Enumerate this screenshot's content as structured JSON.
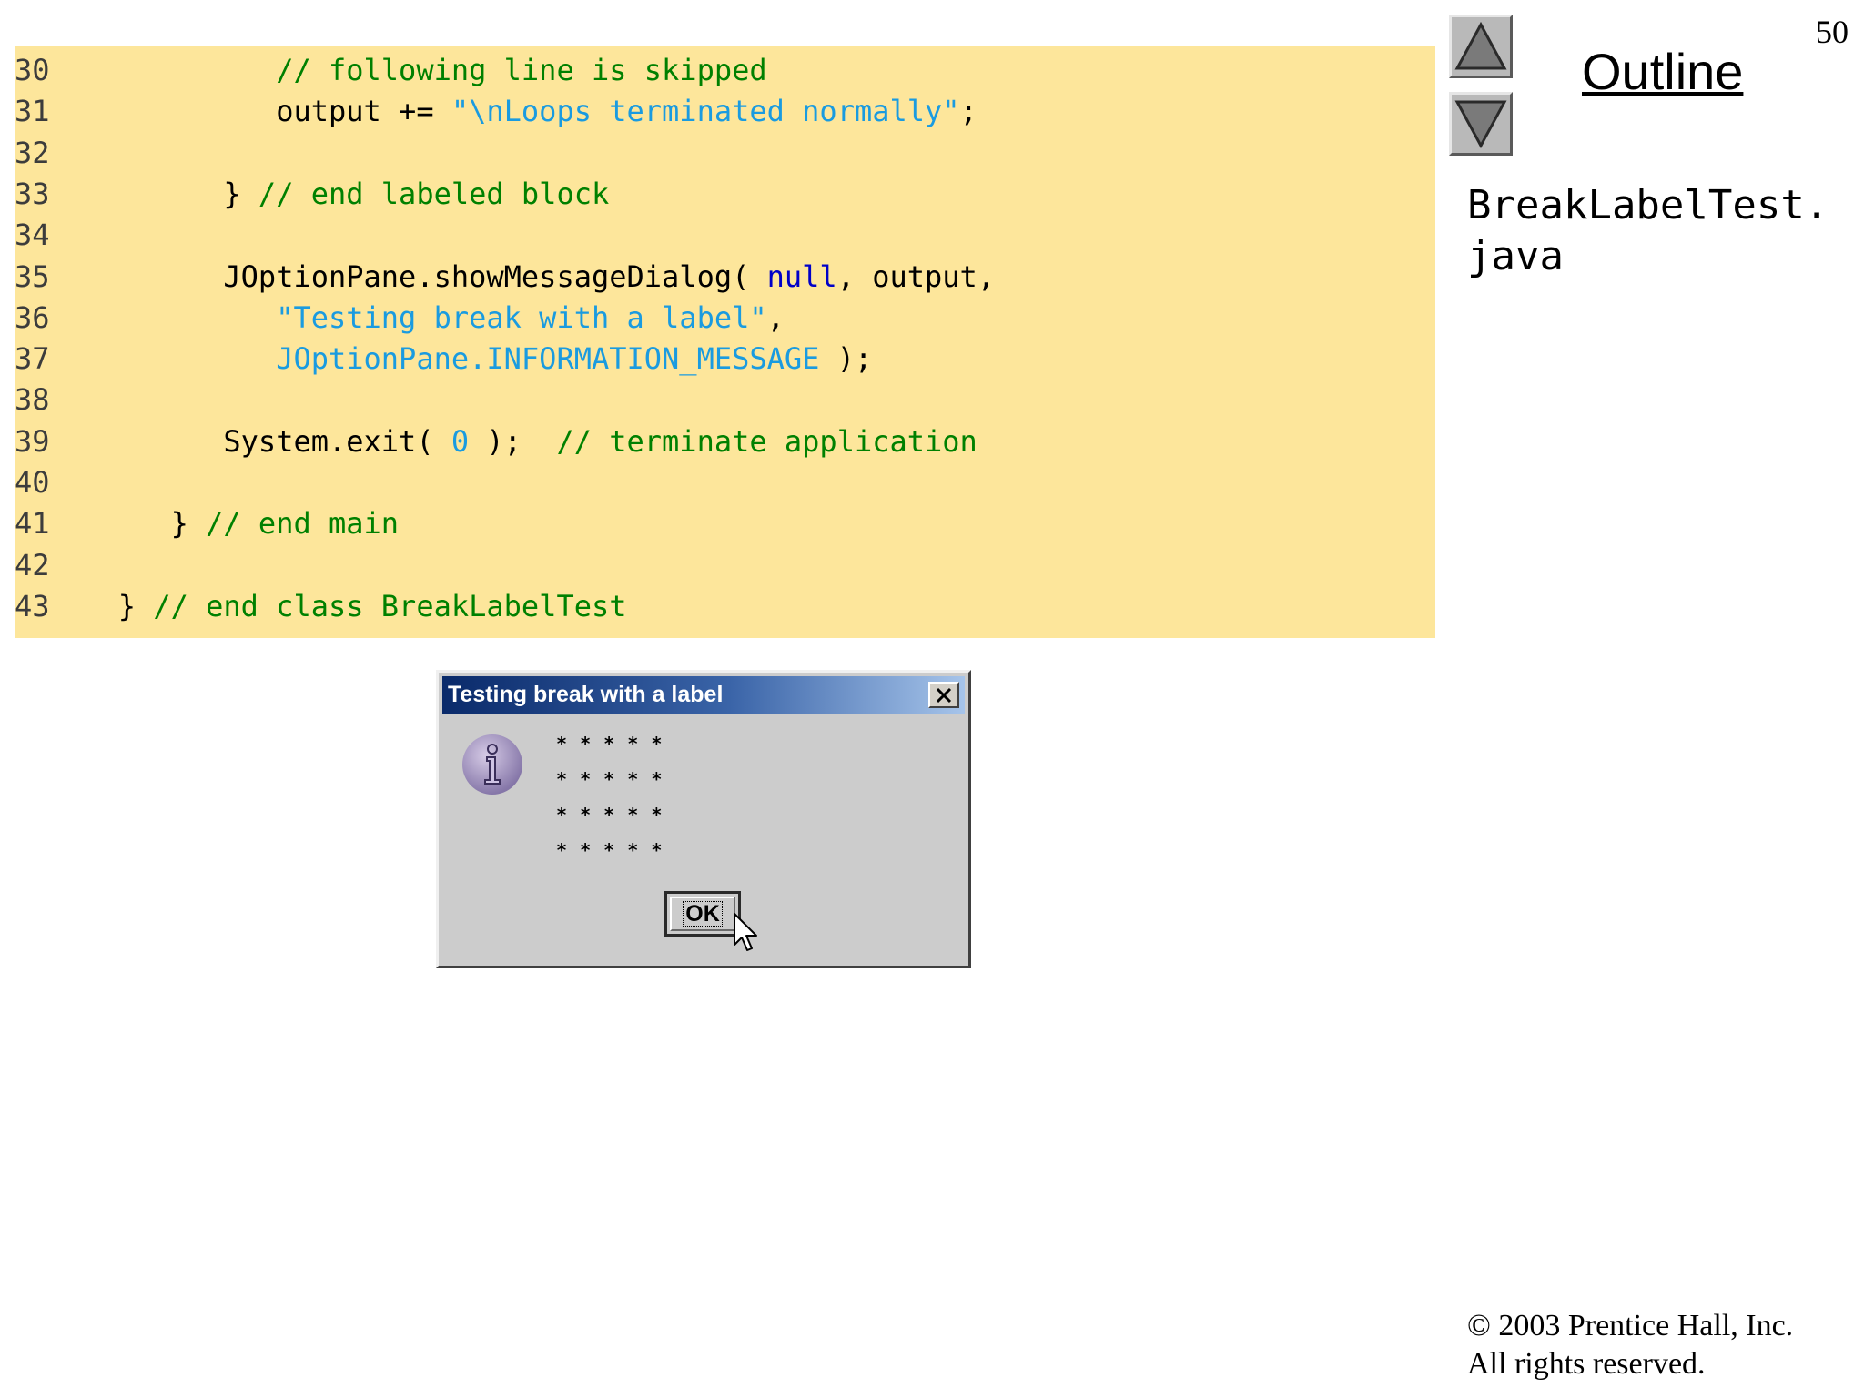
{
  "slide": {
    "page_number": "50",
    "outline_title": "Outline",
    "file_name": "BreakLabelTest.\njava",
    "copyright_line1": "© 2003 Prentice Hall, Inc.",
    "copyright_line2": "All rights reserved."
  },
  "navigation": {
    "up_icon": "triangle-up-icon",
    "down_icon": "triangle-down-icon"
  },
  "code": {
    "background_color": "#fde69b",
    "lines": [
      {
        "number": "30",
        "segments": [
          {
            "text": "            ",
            "type": "plain"
          },
          {
            "text": "// following line is skipped",
            "type": "comment"
          }
        ]
      },
      {
        "number": "31",
        "segments": [
          {
            "text": "            output += ",
            "type": "plain"
          },
          {
            "text": "\"\\nLoops terminated normally\"",
            "type": "string"
          },
          {
            "text": ";",
            "type": "plain"
          }
        ]
      },
      {
        "number": "32",
        "segments": []
      },
      {
        "number": "33",
        "segments": [
          {
            "text": "         } ",
            "type": "plain"
          },
          {
            "text": "// end labeled block",
            "type": "comment"
          }
        ]
      },
      {
        "number": "34",
        "segments": []
      },
      {
        "number": "35",
        "segments": [
          {
            "text": "         JOptionPane.showMessageDialog( ",
            "type": "plain"
          },
          {
            "text": "null",
            "type": "keyword"
          },
          {
            "text": ", output,",
            "type": "plain"
          }
        ]
      },
      {
        "number": "36",
        "segments": [
          {
            "text": "            ",
            "type": "plain"
          },
          {
            "text": "\"Testing break with a label\"",
            "type": "string"
          },
          {
            "text": ",",
            "type": "plain"
          }
        ]
      },
      {
        "number": "37",
        "segments": [
          {
            "text": "            ",
            "type": "plain"
          },
          {
            "text": "JOptionPane.INFORMATION_MESSAGE",
            "type": "string"
          },
          {
            "text": " );",
            "type": "plain"
          }
        ]
      },
      {
        "number": "38",
        "segments": []
      },
      {
        "number": "39",
        "segments": [
          {
            "text": "         System.exit( ",
            "type": "plain"
          },
          {
            "text": "0",
            "type": "number"
          },
          {
            "text": " );  ",
            "type": "plain"
          },
          {
            "text": "// terminate application",
            "type": "comment"
          }
        ]
      },
      {
        "number": "40",
        "segments": []
      },
      {
        "number": "41",
        "segments": [
          {
            "text": "      } ",
            "type": "plain"
          },
          {
            "text": "// end main",
            "type": "comment"
          }
        ]
      },
      {
        "number": "42",
        "segments": []
      },
      {
        "number": "43",
        "segments": [
          {
            "text": "   } ",
            "type": "plain"
          },
          {
            "text": "// end class BreakLabelTest",
            "type": "comment"
          }
        ]
      }
    ]
  },
  "dialog": {
    "title": "Testing break with a label",
    "close_icon": "close-icon",
    "message_icon": "information-icon",
    "message_lines": [
      "* * * * *",
      "* * * * *",
      "* * * * *",
      "* * * * *"
    ],
    "ok_label": "OK",
    "cursor_icon": "mouse-pointer-icon"
  }
}
